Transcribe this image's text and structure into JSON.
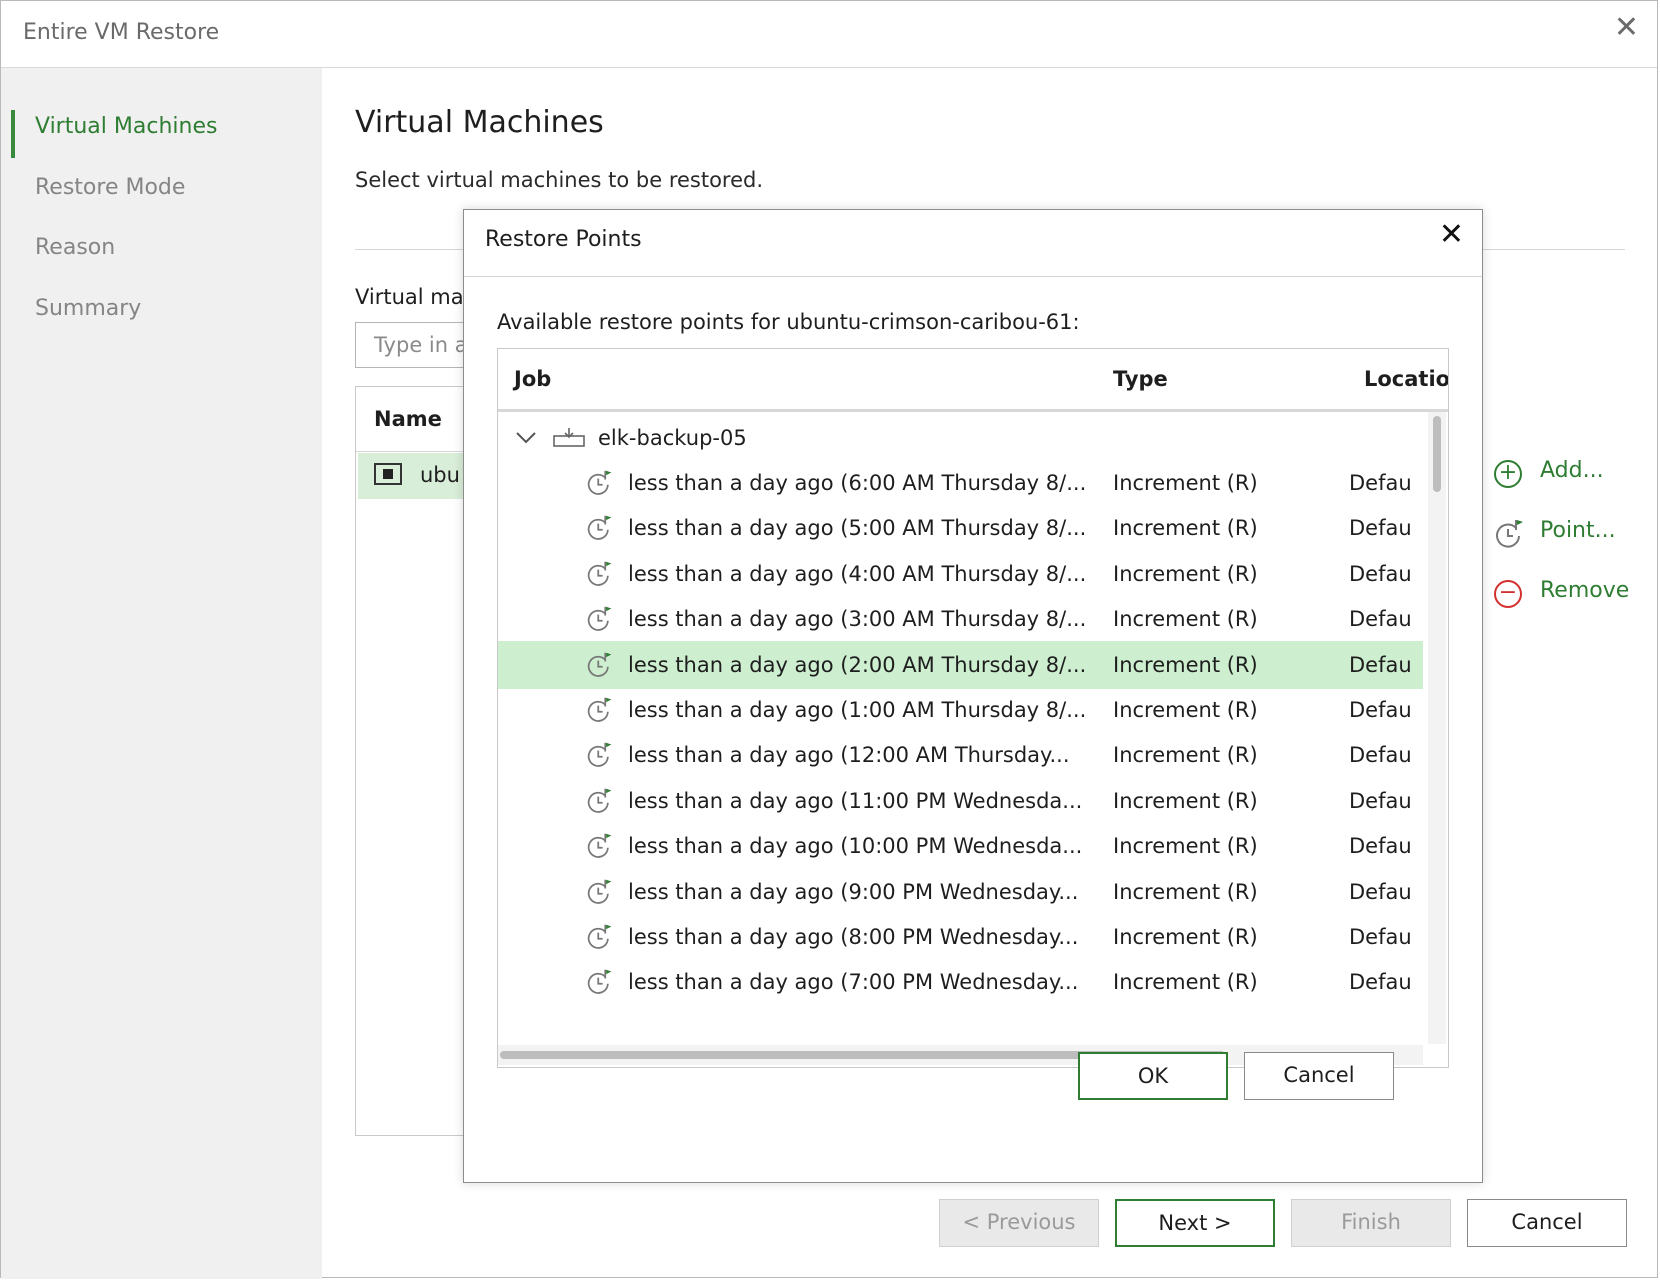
{
  "window": {
    "title": "Entire VM Restore",
    "close": "✕"
  },
  "sidebar": {
    "items": [
      {
        "label": "Virtual Machines",
        "active": true
      },
      {
        "label": "Restore Mode",
        "active": false
      },
      {
        "label": "Reason",
        "active": false
      },
      {
        "label": "Summary",
        "active": false
      }
    ]
  },
  "main": {
    "heading": "Virtual Machines",
    "subheading": "Select virtual machines to be restored.",
    "vm_list_label": "Virtual ma",
    "search_placeholder": "Type in a",
    "table_header": "Name",
    "vm_row": "ubu",
    "actions": {
      "add": "Add...",
      "point": "Point...",
      "remove": "Remove"
    }
  },
  "footer": {
    "previous": "< Previous",
    "next": "Next >",
    "finish": "Finish",
    "cancel": "Cancel"
  },
  "dialog": {
    "title": "Restore Points",
    "close": "✕",
    "available": "Available restore points for ubuntu-crimson-caribou-61:",
    "columns": {
      "job": "Job",
      "type": "Type",
      "location": "Locatio"
    },
    "job_name": "elk-backup-05",
    "rows": [
      {
        "job": "less than a day ago (6:00 AM Thursday 8/...",
        "type": "Increment (R)",
        "location": "Defau"
      },
      {
        "job": "less than a day ago (5:00 AM Thursday 8/...",
        "type": "Increment (R)",
        "location": "Defau"
      },
      {
        "job": "less than a day ago (4:00 AM Thursday 8/...",
        "type": "Increment (R)",
        "location": "Defau"
      },
      {
        "job": "less than a day ago (3:00 AM Thursday 8/...",
        "type": "Increment (R)",
        "location": "Defau"
      },
      {
        "job": "less than a day ago (2:00 AM Thursday 8/...",
        "type": "Increment (R)",
        "location": "Defau"
      },
      {
        "job": "less than a day ago (1:00 AM Thursday 8/...",
        "type": "Increment (R)",
        "location": "Defau"
      },
      {
        "job": "less than a day ago (12:00 AM Thursday...",
        "type": "Increment (R)",
        "location": "Defau"
      },
      {
        "job": "less than a day ago (11:00 PM Wednesda...",
        "type": "Increment (R)",
        "location": "Defau"
      },
      {
        "job": "less than a day ago (10:00 PM Wednesda...",
        "type": "Increment (R)",
        "location": "Defau"
      },
      {
        "job": "less than a day ago (9:00 PM Wednesday...",
        "type": "Increment (R)",
        "location": "Defau"
      },
      {
        "job": "less than a day ago (8:00 PM Wednesday...",
        "type": "Increment (R)",
        "location": "Defau"
      },
      {
        "job": "less than a day ago (7:00 PM Wednesday...",
        "type": "Increment (R)",
        "location": "Defau"
      }
    ],
    "selected_index": 4,
    "ok": "OK",
    "cancel": "Cancel"
  },
  "colors": {
    "accent": "#2e7d32",
    "selection": "#cdeecf",
    "remove": "#d32f2f"
  }
}
